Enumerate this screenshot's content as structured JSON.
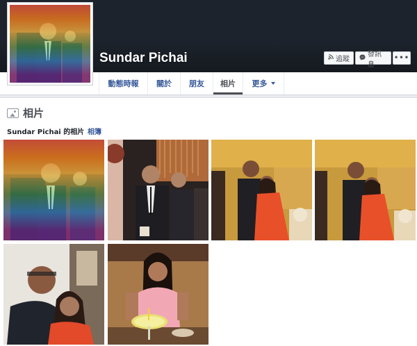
{
  "profile": {
    "name": "Sundar Pichai"
  },
  "actions": {
    "follow_label": "追蹤",
    "message_label": "發訊息",
    "more_label": "•••"
  },
  "nav": {
    "timeline": "動態時報",
    "about": "關於",
    "friends": "朋友",
    "photos": "相片",
    "more": "更多"
  },
  "photos_section": {
    "title": "相片",
    "tab_user_photos": "Sundar Pichai 的相片",
    "tab_albums": "相簿"
  },
  "icons": {
    "follow": "rss-icon",
    "message": "messenger-icon",
    "section": "photos-icon"
  },
  "colors": {
    "cover": "#1d232c",
    "link": "#365899",
    "page_bg": "#e9ebee"
  }
}
